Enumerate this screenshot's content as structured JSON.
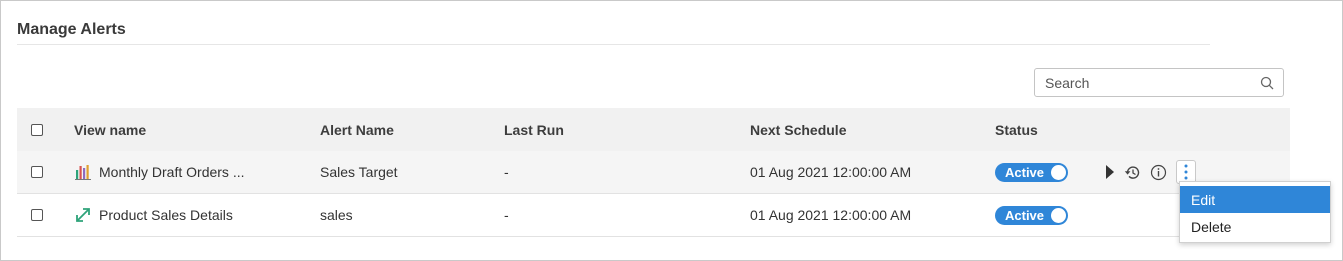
{
  "page": {
    "title": "Manage Alerts"
  },
  "search": {
    "placeholder": "Search",
    "value": ""
  },
  "table": {
    "columns": [
      "View name",
      "Alert Name",
      "Last Run",
      "Next Schedule",
      "Status"
    ],
    "rows": [
      {
        "view_name": "Monthly Draft Orders ...",
        "view_icon": "bar-chart-icon",
        "alert_name": "Sales Target",
        "last_run": "-",
        "next_schedule": "01 Aug 2021 12:00:00 AM",
        "status": "Active"
      },
      {
        "view_name": "Product Sales Details",
        "view_icon": "expand-arrows-icon",
        "alert_name": "sales",
        "last_run": "-",
        "next_schedule": "01 Aug 2021 12:00:00 AM",
        "status": "Active"
      }
    ]
  },
  "row_actions": [
    "play-icon",
    "history-icon",
    "info-icon",
    "more-vertical-icon"
  ],
  "context_menu": {
    "items": [
      "Edit",
      "Delete"
    ],
    "highlighted": "Edit"
  },
  "colors": {
    "accent": "#2f86d8",
    "header_bg": "#f1f1f1",
    "row_alt_bg": "#f5f5f5",
    "icon_green": "#2ea37a"
  }
}
